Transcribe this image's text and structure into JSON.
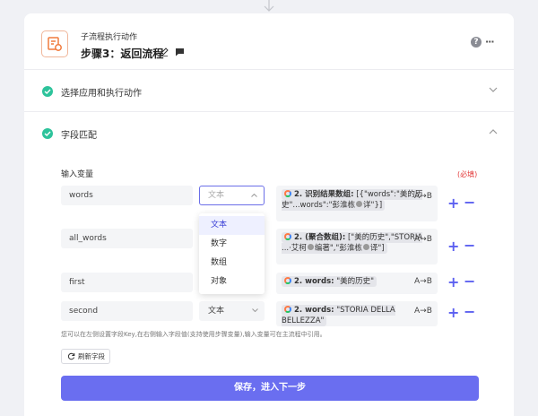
{
  "header": {
    "subtitle": "子流程执行动作",
    "title": "步骤3：返回流程"
  },
  "sections": {
    "select_app": "选择应用和执行动作",
    "field_match": "字段匹配"
  },
  "variables": {
    "heading": "输入变量",
    "required": "(必填)",
    "rows": [
      {
        "name": "words",
        "type": "文本",
        "value_prefix": "2. 识别结果数组:",
        "value_text": " [{\"words\":\"美的历史\"...words\":\"彭淮栋",
        "value_tail": "详\"}]",
        "map": "A→B"
      },
      {
        "name": "all_words",
        "type": "",
        "value_prefix": "2. (聚合数组):",
        "value_text": " [\"美的历史\",\"STORIA ...·艾柯",
        "value_mid": "编著\",\"彭淮栋",
        "value_tail": "译\"]",
        "map": "A→B"
      },
      {
        "name": "first",
        "type": "",
        "value_prefix": "2. words:",
        "value_text": " \"美的历史\"",
        "map": "A→B"
      },
      {
        "name": "second",
        "type": "文本",
        "value_prefix": "2. words:",
        "value_text": " \"STORIA DELLA BELLEZZA\"",
        "map": "A→B"
      }
    ],
    "dropdown_placeholder": "文本",
    "dropdown_options": [
      "文本",
      "数字",
      "数组",
      "对象"
    ]
  },
  "hint": "您可以在左侧设置字段Key,在右侧输入字段值(支持使用步骤变量),输入变量可在主流程中引用。",
  "refresh_label": "刷新字段",
  "save_label": "保存，进入下一步",
  "colors": {
    "accent": "#6a6ef0",
    "success": "#2dc39b",
    "required": "#e33b3b",
    "app_icon": "#f07a3c"
  }
}
